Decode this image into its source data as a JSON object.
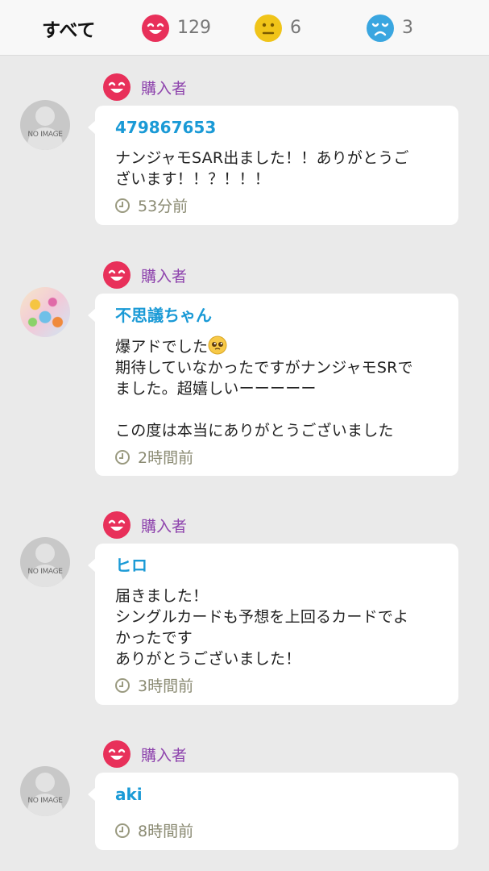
{
  "tabs": {
    "all": {
      "label": "すべて"
    },
    "good": {
      "count": "129",
      "icon": "happy-face-icon",
      "color": "#e8305a"
    },
    "normal": {
      "count": "6",
      "icon": "neutral-face-icon",
      "color": "#f0c419"
    },
    "bad": {
      "count": "3",
      "icon": "sad-face-icon",
      "color": "#3aa6e0"
    }
  },
  "buyer_label": "購入者",
  "no_image_text": "NO IMAGE",
  "reviews": [
    {
      "username": "479867653",
      "comment": "ナンジャモSAR出ました！！ありがとうご\nざいます！！？！！！",
      "time": "53分前",
      "avatar": "no-image"
    },
    {
      "username": "不思議ちゃん",
      "comment_line1": "爆アドでした",
      "comment_emoji": "pleading-face-icon",
      "comment_rest": "期待していなかったですがナンジャモSRで\nました。超嬉しいーーーーー\n\nこの度は本当にありがとうございました",
      "time": "2時間前",
      "avatar": "picture"
    },
    {
      "username": "ヒロ",
      "comment": "届きました！\nシングルカードも予想を上回るカードでよ\nかったです\nありがとうございました！",
      "time": "3時間前",
      "avatar": "no-image"
    },
    {
      "username": "aki",
      "comment": "",
      "time": "8時間前",
      "avatar": "no-image"
    }
  ],
  "colors": {
    "accent_blue": "#1a9ad6",
    "buyer_purple": "#8e44ad",
    "happy_red": "#e8305a"
  }
}
